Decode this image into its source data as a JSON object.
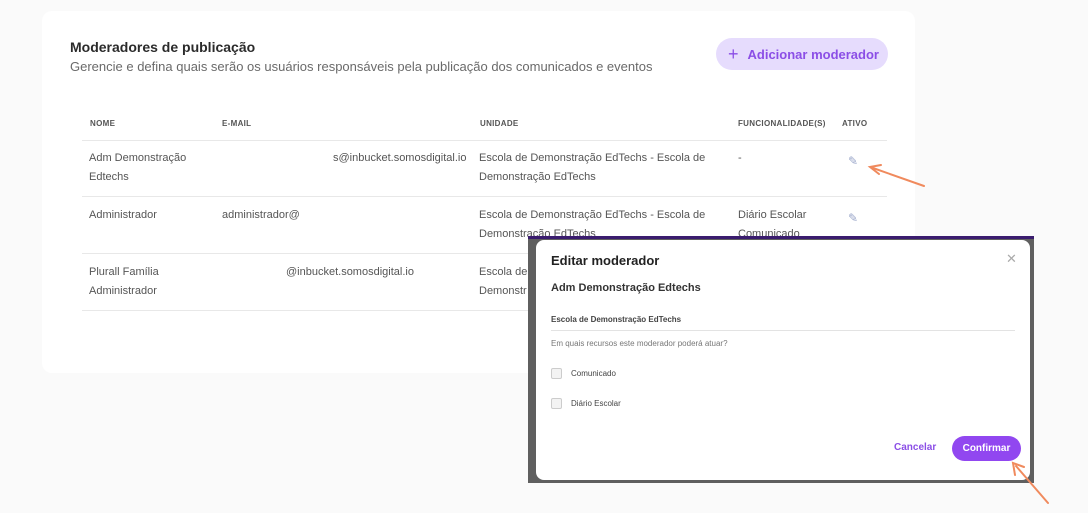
{
  "header": {
    "title": "Moderadores de publicação",
    "subtitle": "Gerencie e defina quais serão os usuários responsáveis pela publicação dos comunicados e eventos",
    "add_button_icon": "plus-icon",
    "add_button_label": "Adicionar moderador"
  },
  "table": {
    "columns": [
      "NOME",
      "E-MAIL",
      "UNIDADE",
      "FUNCIONALIDADE(S)",
      "ATIVO"
    ],
    "rows": [
      {
        "name_l1": "Adm Demonstração",
        "name_l2": "Edtechs",
        "email": "s@inbucket.somosdigital.io",
        "unit_l1": "Escola de Demonstração EdTechs - Escola de",
        "unit_l2": "Demonstração EdTechs",
        "func_l1": "-",
        "func_l2": "",
        "icon": "edit-icon"
      },
      {
        "name_l1": "Administrador",
        "name_l2": "",
        "email": "administrador@",
        "unit_l1": "Escola de Demonstração EdTechs - Escola de",
        "unit_l2": "Demonstração EdTechs",
        "func_l1": "Diário Escolar",
        "func_l2": "Comunicado",
        "icon": "edit-icon"
      },
      {
        "name_l1": "Plurall Família",
        "name_l2": "Administrador",
        "email": "@inbucket.somosdigital.io",
        "unit_l1": "Escola de",
        "unit_l2": "Demonstr",
        "func_l1": "",
        "func_l2": "",
        "icon": ""
      }
    ]
  },
  "modal": {
    "title": "Editar moderador",
    "close_icon": "close-icon",
    "moderator_name": "Adm Demonstração Edtechs",
    "school": "Escola de Demonstração EdTechs",
    "question": "Em quais recursos este moderador poderá atuar?",
    "options": [
      {
        "label": "Comunicado",
        "checked": false
      },
      {
        "label": "Diário Escolar",
        "checked": false
      }
    ],
    "cancel_label": "Cancelar",
    "confirm_label": "Confirmar"
  },
  "colors": {
    "accent": "#9147f0",
    "accent_light": "#e6dcfd",
    "annotation_arrow": "#f08a5d"
  }
}
